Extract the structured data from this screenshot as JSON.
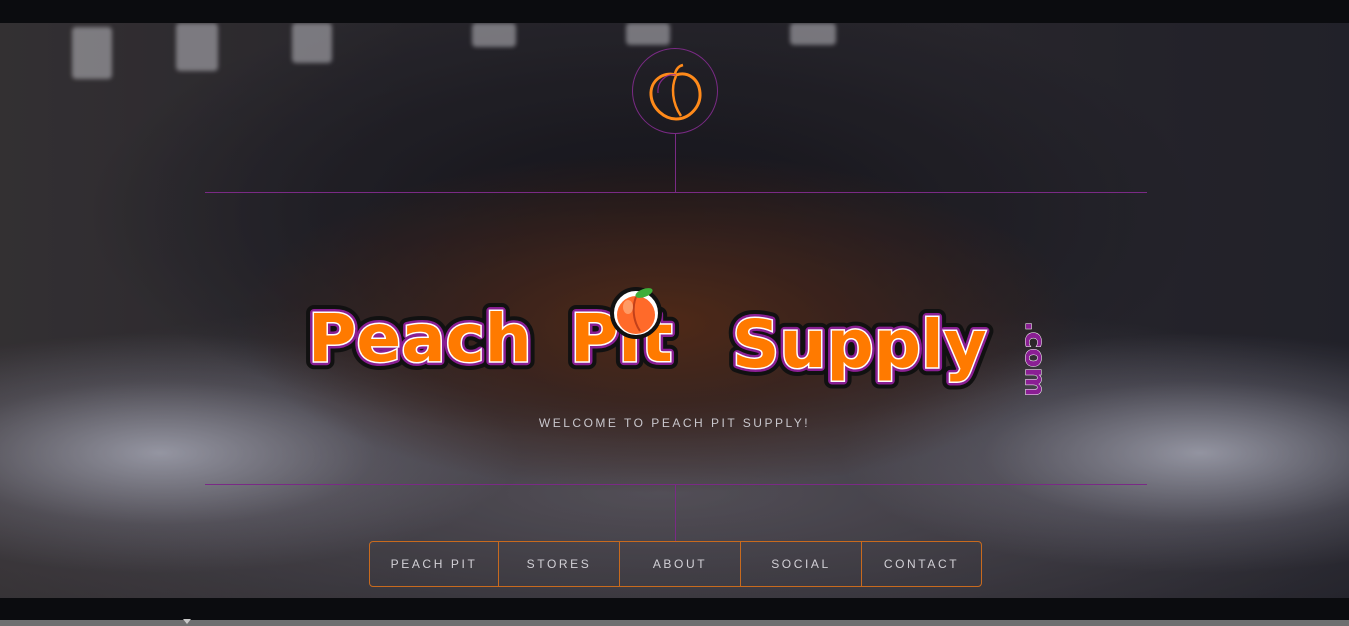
{
  "brand": {
    "logo_word_1": "Peach",
    "logo_word_2": "Pit",
    "logo_word_3": "Supply",
    "logo_suffix": ".com",
    "emblem_icon": "peach-outline-icon",
    "logo_peach_icon": "peach-icon"
  },
  "hero": {
    "welcome_text": "WELCOME TO PEACH PIT SUPPLY!"
  },
  "nav": {
    "items": [
      {
        "label": "PEACH PIT"
      },
      {
        "label": "STORES"
      },
      {
        "label": "ABOUT"
      },
      {
        "label": "SOCIAL"
      },
      {
        "label": "CONTACT"
      }
    ]
  },
  "colors": {
    "accent_line": "#7a2a85",
    "nav_border": "#c86a1e",
    "logo_orange": "#ff7a00",
    "logo_purple": "#8a1f93"
  }
}
